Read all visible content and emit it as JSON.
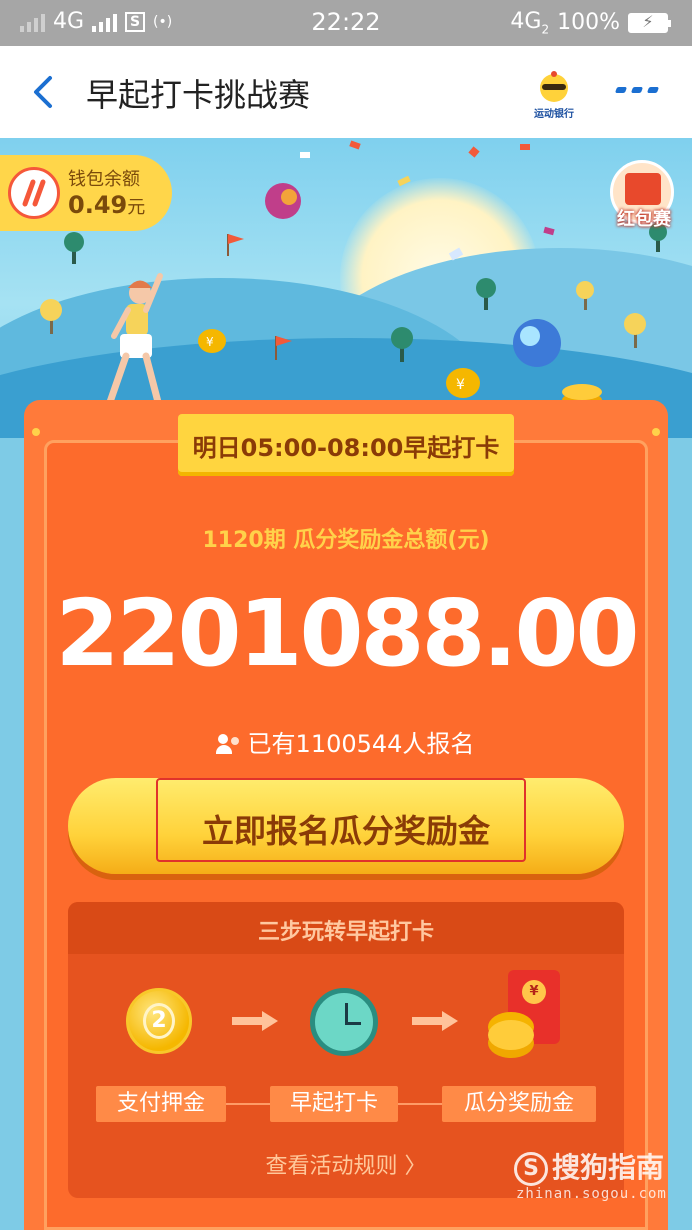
{
  "status_bar": {
    "network_left": "4G",
    "time": "22:22",
    "network_right": "4G",
    "network_right_sub": "2",
    "battery": "100%",
    "sim_icon": "S",
    "hotspot_icon": "(•)"
  },
  "nav": {
    "title": "早起打卡挑战赛",
    "logo_text": "运动银行",
    "more_icon": "more-icon"
  },
  "hero": {
    "wallet_label": "钱包余额",
    "wallet_value": "0.49",
    "wallet_unit": "元",
    "redpack_label": "红包赛"
  },
  "card": {
    "badge": "明日05:00-08:00早起打卡",
    "period": "1120期 瓜分奖励金总额(元)",
    "pool_amount": "2201088.00",
    "signed_up": "已有1100544人报名",
    "cta_label": "立即报名瓜分奖励金"
  },
  "steps": {
    "title": "三步玩转早起打卡",
    "coin_number": "2",
    "envelope_symbol": "¥",
    "items": [
      "支付押金",
      "早起打卡",
      "瓜分奖励金"
    ],
    "rules_link": "查看活动规则 〉"
  },
  "watermark": {
    "logo": "S",
    "brand": "搜狗指南",
    "url": "zhinan.sogou.com"
  },
  "colors": {
    "accent_blue": "#1b6fd1",
    "card_orange": "#fd6b2c",
    "cta_yellow": "#ffd23a",
    "text_brown": "#8a3b07"
  }
}
